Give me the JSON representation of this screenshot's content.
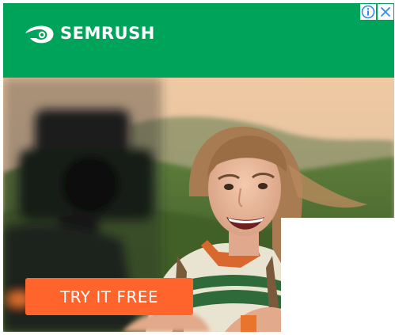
{
  "ad": {
    "brand_name": "SEMRUSH",
    "cta_label": "TRY IT FREE",
    "icons": {
      "logo": "semrush-fireball-logo",
      "info": "info-icon",
      "close": "close-icon"
    },
    "colors": {
      "brand_green": "#00a35a",
      "cta_orange": "#ff642d",
      "adchoices_blue": "#2d8cf0"
    }
  }
}
